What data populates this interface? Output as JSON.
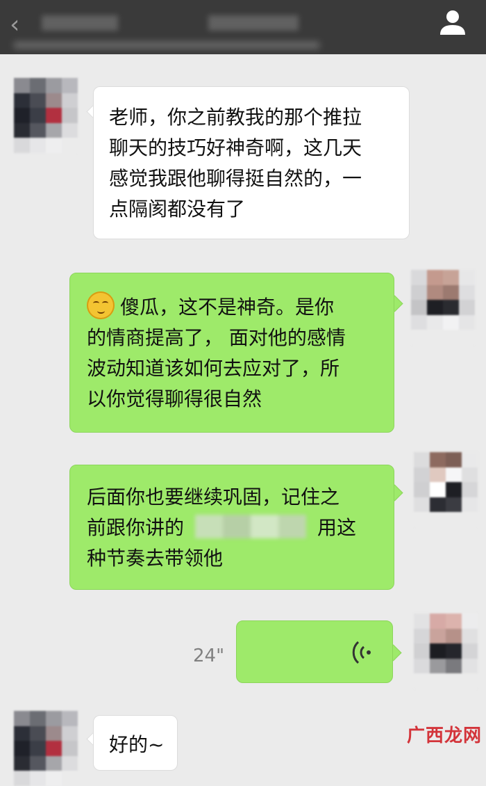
{
  "header": {
    "back_icon": "chevron-left-icon",
    "profile_icon": "user-profile-icon"
  },
  "messages": [
    {
      "side": "left",
      "lines": [
        "老师，你之前教我的那个推拉",
        "聊天的技巧好神奇啊，这几天",
        "感觉我跟他聊得挺自然的，一",
        "点隔阂都没有了"
      ]
    },
    {
      "side": "right",
      "emoji": "grinning-face-with-hand-icon",
      "lines": [
        "傻瓜，这不是神奇。是你",
        "的情商提高了， 面对他的感情",
        "波动知道该如何去应对了，所",
        "以你觉得聊得很自然"
      ]
    },
    {
      "side": "right",
      "lines": [
        "后面你也要继续巩固，记住之",
        "前跟你讲的",
        "用这",
        "种节奏去带领他"
      ]
    },
    {
      "side": "right",
      "type": "voice",
      "duration": "24\"",
      "icon": "voice-wave-icon"
    },
    {
      "side": "left",
      "lines": [
        "好的~"
      ]
    }
  ],
  "watermark": {
    "text": "广西龙网"
  },
  "colors": {
    "header_bg": "#3a3a3a",
    "chat_bg": "#ebebeb",
    "bubble_self": "#9eea6a",
    "bubble_other": "#ffffff"
  }
}
